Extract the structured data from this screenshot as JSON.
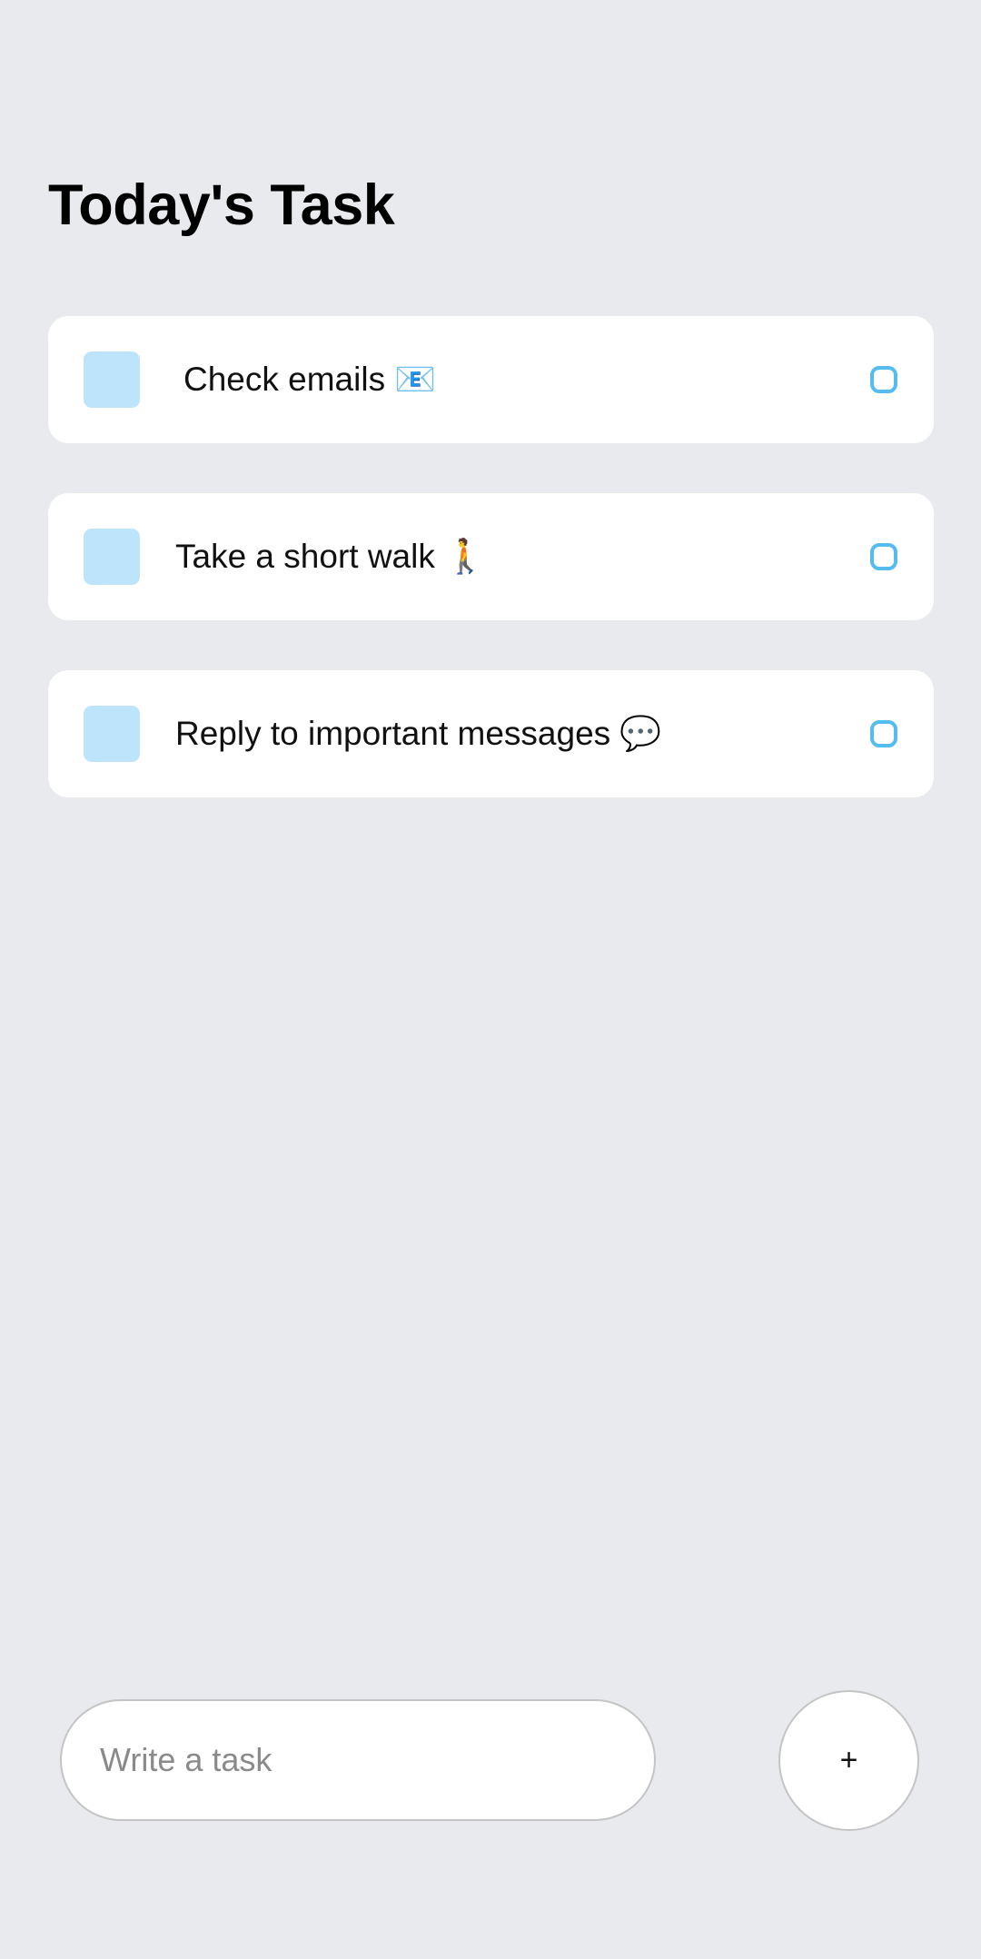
{
  "header": {
    "title": "Today's Task"
  },
  "tasks": [
    {
      "text": "Check emails 📧"
    },
    {
      "text": "Take a short walk 🚶"
    },
    {
      "text": "Reply to important messages 💬"
    }
  ],
  "composer": {
    "placeholder": "Write a task",
    "add_label": "+"
  },
  "colors": {
    "background": "#e8eaed",
    "card": "#ffffff",
    "task_square": "#bde4fa",
    "task_circle": "#55bcef"
  }
}
